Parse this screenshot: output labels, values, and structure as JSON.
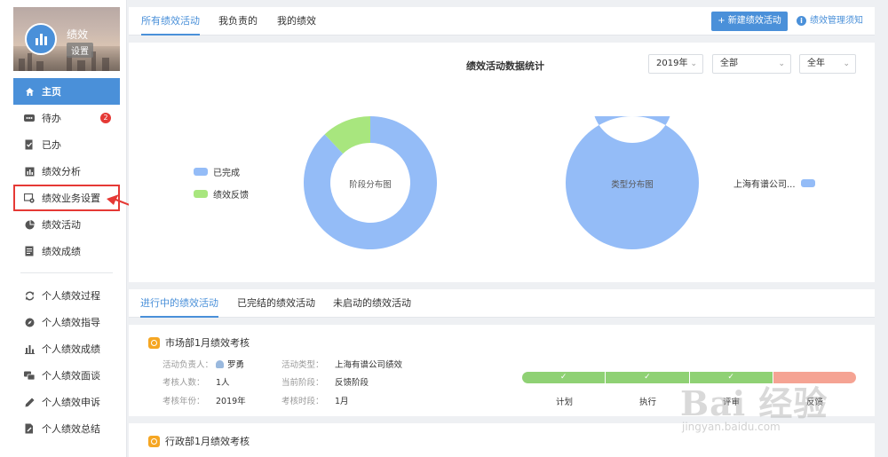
{
  "app": {
    "title": "绩效",
    "settings_tag": "设置"
  },
  "sidebar": {
    "items": [
      {
        "label": "主页",
        "icon": "home-icon"
      },
      {
        "label": "待办",
        "icon": "more-icon",
        "badge": "2"
      },
      {
        "label": "已办",
        "icon": "done-doc-icon"
      },
      {
        "label": "绩效分析",
        "icon": "bar-chart-icon"
      },
      {
        "label": "绩效业务设置",
        "icon": "settings-screen-icon"
      },
      {
        "label": "绩效活动",
        "icon": "pie-icon"
      },
      {
        "label": "绩效成绩",
        "icon": "list-icon"
      }
    ],
    "personal_items": [
      {
        "label": "个人绩效过程",
        "icon": "refresh-icon"
      },
      {
        "label": "个人绩效指导",
        "icon": "compass-icon"
      },
      {
        "label": "个人绩效成绩",
        "icon": "bar-chart-icon"
      },
      {
        "label": "个人绩效面谈",
        "icon": "chat-icon"
      },
      {
        "label": "个人绩效申诉",
        "icon": "pen-icon"
      },
      {
        "label": "个人绩效总结",
        "icon": "doc-edit-icon"
      }
    ]
  },
  "top_tabs": [
    "所有绩效活动",
    "我负责的",
    "我的绩效"
  ],
  "toolbar": {
    "new_button": "+ 新建绩效活动",
    "help_link": "绩效管理须知"
  },
  "stats": {
    "title": "绩效活动数据统计",
    "filters": {
      "year": "2019年",
      "scope": "全部",
      "period": "全年"
    }
  },
  "chart_data": [
    {
      "type": "pie",
      "center_label": "阶段分布图",
      "categories": [
        "已完成",
        "绩效反馈"
      ],
      "values": [
        88,
        12
      ],
      "colors": [
        "#94bcf7",
        "#a8e67e"
      ],
      "legend_position": "left"
    },
    {
      "type": "pie",
      "center_label": "类型分布图",
      "categories": [
        "上海有谱公司..."
      ],
      "values": [
        100
      ],
      "colors": [
        "#94bcf7"
      ],
      "legend_position": "right"
    }
  ],
  "activity_tabs": [
    "进行中的绩效活动",
    "已完结的绩效活动",
    "未启动的绩效活动"
  ],
  "cards": [
    {
      "title": "市场部1月绩效考核",
      "fields": {
        "owner_label": "活动负责人：",
        "owner": "罗勇",
        "type_label": "活动类型：",
        "type": "上海有谱公司绩效",
        "count_label": "考核人数：",
        "count": "1人",
        "stage_label": "当前阶段：",
        "stage": "反馈阶段",
        "year_label": "考核年份：",
        "year": "2019年",
        "period_label": "考核时段：",
        "period": "1月"
      },
      "progress": {
        "completed_steps": 3,
        "total_steps": 4,
        "check": "✓",
        "stages": [
          "计划",
          "执行",
          "评审",
          "反馈"
        ]
      }
    },
    {
      "title": "行政部1月绩效考核"
    }
  ],
  "watermark": {
    "brand": "Bai 经验",
    "url": "jingyan.baidu.com"
  }
}
